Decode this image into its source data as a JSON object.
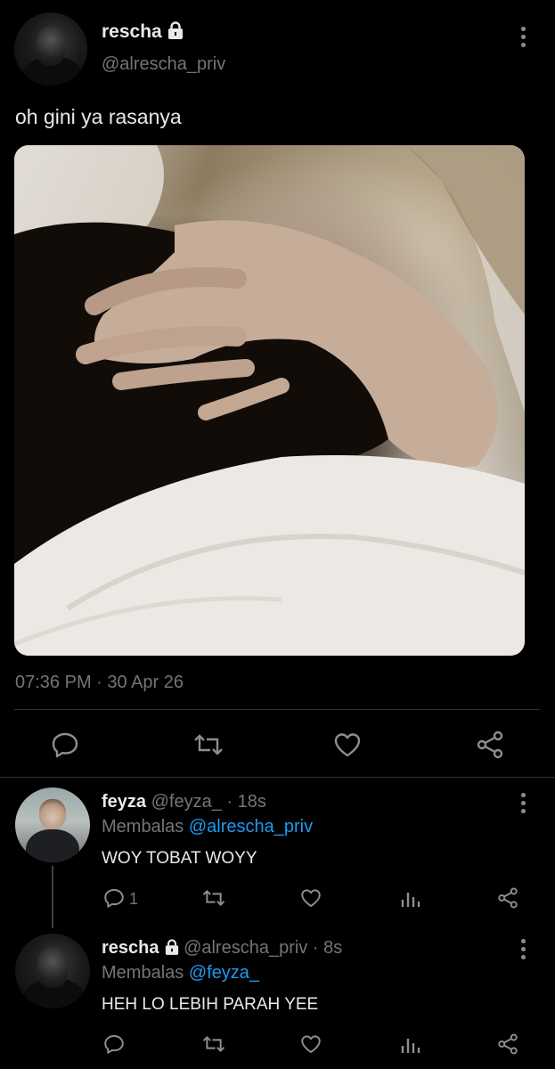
{
  "tweet": {
    "author_name": "rescha",
    "author_handle": "@alrescha_priv",
    "text": "oh gini ya rasanya",
    "timestamp": "07:36 PM · 30 Apr 26"
  },
  "replies": [
    {
      "author_name": "feyza",
      "author_handle": "@feyza_",
      "time": "· 18s",
      "replying_prefix": "Membalas",
      "replying_to": "@alrescha_priv",
      "text": "WOY TOBAT WOYY",
      "reply_count": "1"
    },
    {
      "author_name": "rescha",
      "author_handle": "@alrescha_priv",
      "time": "· 8s",
      "replying_prefix": "Membalas",
      "replying_to": "@feyza_",
      "text": "HEH LO LEBIH PARAH YEE",
      "reply_count": ""
    }
  ],
  "icons": {
    "lock": "lock-icon",
    "more": "more-options-icon",
    "reply": "reply-icon",
    "retweet": "retweet-icon",
    "like": "like-icon",
    "share": "share-icon",
    "analytics": "analytics-icon"
  },
  "colors": {
    "background": "#000000",
    "text": "#e7e9ea",
    "muted": "#71767b",
    "link": "#1d9bf0",
    "divider": "#2f3336"
  }
}
